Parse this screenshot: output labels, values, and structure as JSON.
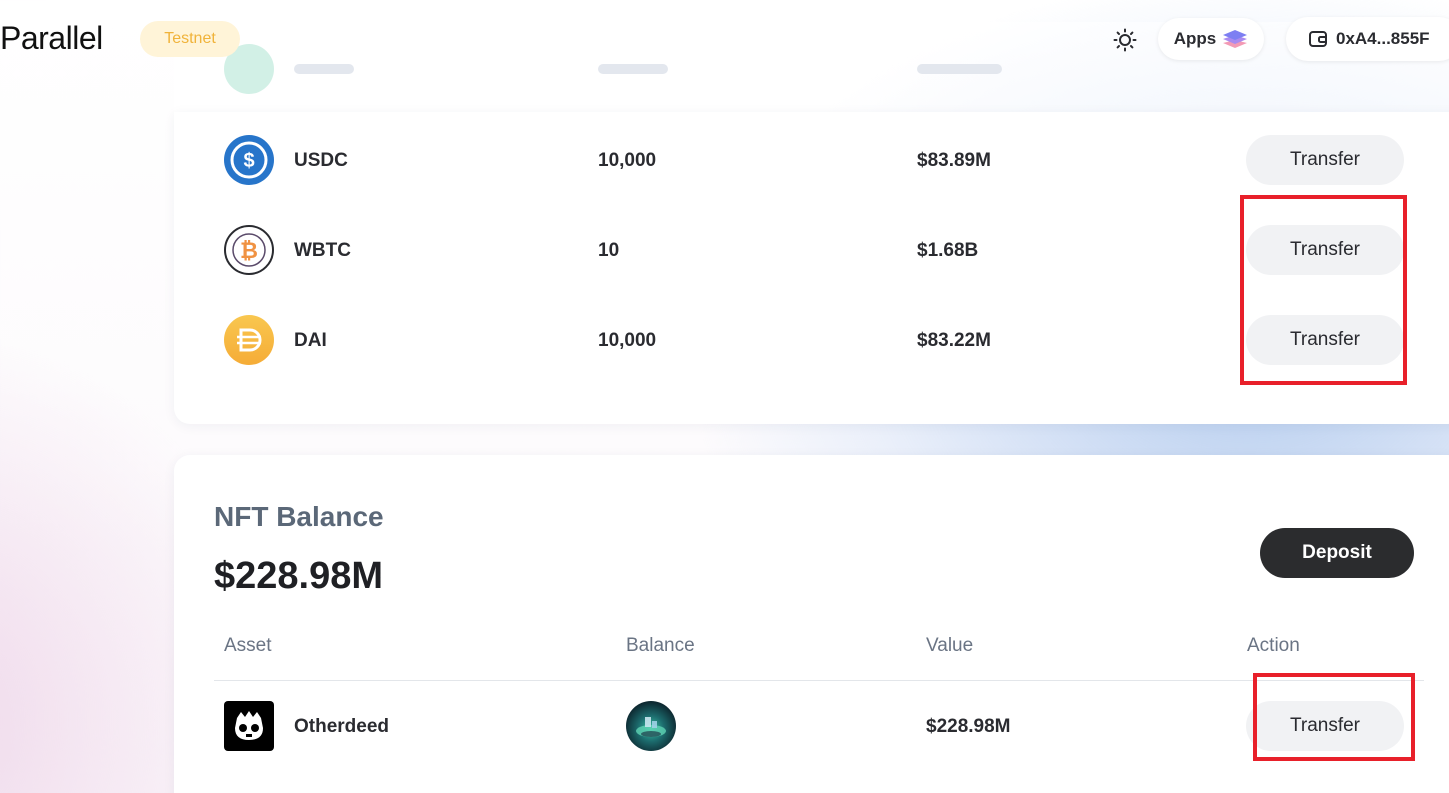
{
  "header": {
    "logo": "Parallel",
    "network_badge": "Testnet",
    "theme_icon": "sun-icon",
    "apps_label": "Apps",
    "apps_icon": "layers-icon",
    "wallet_icon": "wallet-icon",
    "wallet_address": "0xA4...855F"
  },
  "tokens": {
    "rows": [
      {
        "symbol": "USDC",
        "balance": "10,000",
        "value": "$83.89M",
        "action": "Transfer",
        "icon": "usdc-icon",
        "color": "#2775CA"
      },
      {
        "symbol": "WBTC",
        "balance": "10",
        "value": "$1.68B",
        "action": "Transfer",
        "icon": "wbtc-icon",
        "color": "#F09242"
      },
      {
        "symbol": "DAI",
        "balance": "10,000",
        "value": "$83.22M",
        "action": "Transfer",
        "icon": "dai-icon",
        "color": "#F5AC37"
      }
    ]
  },
  "nft": {
    "title": "NFT Balance",
    "total": "$228.98M",
    "deposit_label": "Deposit",
    "columns": [
      "Asset",
      "Balance",
      "Value",
      "Action"
    ],
    "rows": [
      {
        "name": "Otherdeed",
        "value": "$228.98M",
        "action": "Transfer",
        "icon": "otherdeed-logo",
        "thumbnail": "otherdeed-nft-thumbnail"
      }
    ]
  },
  "colors": {
    "accent_dark": "#2B2C2E",
    "badge_bg": "#FFF4D8",
    "badge_text": "#F0B33A",
    "highlight": "#E8202A"
  }
}
